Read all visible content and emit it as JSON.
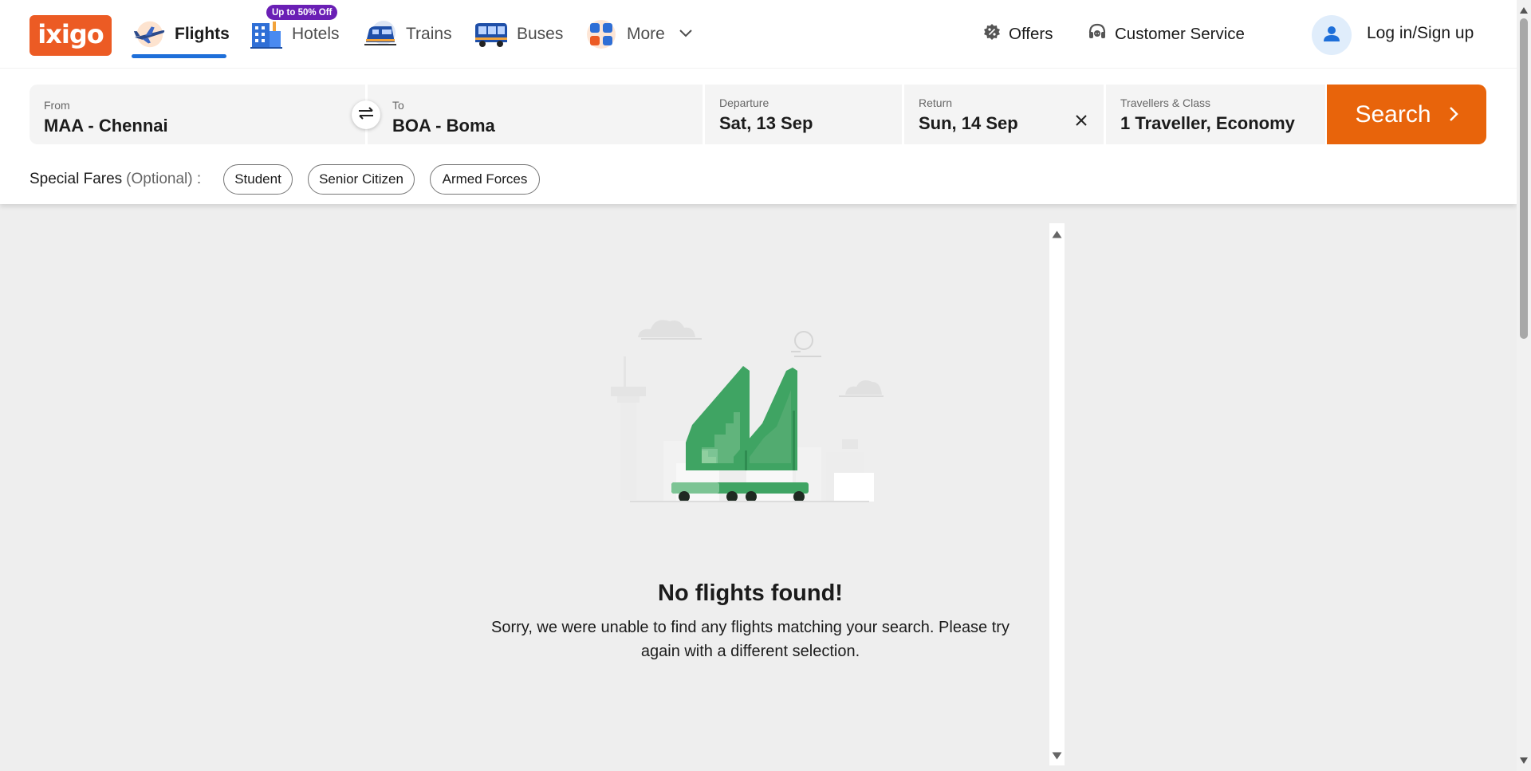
{
  "brand": {
    "logo_text": "ixigo"
  },
  "nav": {
    "items": [
      {
        "label": "Flights",
        "icon": "airplane-icon",
        "active": true
      },
      {
        "label": "Hotels",
        "icon": "hotel-building-icon",
        "badge": "Up to 50% Off"
      },
      {
        "label": "Trains",
        "icon": "train-icon"
      },
      {
        "label": "Buses",
        "icon": "bus-icon"
      },
      {
        "label": "More",
        "icon": "apps-grid-icon"
      }
    ]
  },
  "header_right": {
    "offers": "Offers",
    "customer_service": "Customer Service",
    "login": "Log in/Sign up"
  },
  "search": {
    "from": {
      "label": "From",
      "value": "MAA - Chennai"
    },
    "to": {
      "label": "To",
      "value": "BOA - Boma"
    },
    "departure": {
      "label": "Departure",
      "value": "Sat, 13 Sep"
    },
    "return": {
      "label": "Return",
      "value": "Sun, 14 Sep"
    },
    "travellers": {
      "label": "Travellers & Class",
      "value": "1 Traveller, Economy"
    },
    "button": "Search"
  },
  "special_fares": {
    "label": "Special Fares",
    "optional": "(Optional) :",
    "options": [
      "Student",
      "Senior Citizen",
      "Armed Forces"
    ]
  },
  "empty_state": {
    "title": "No flights found!",
    "message": "Sorry, we were unable to find any flights matching your search. Please try again with a different selection."
  },
  "colors": {
    "brand_orange": "#ec5b24",
    "search_button": "#e8640b",
    "active_underline": "#1e6fd9",
    "badge_purple": "#6a1fb5",
    "illustration_green": "#3fa463"
  }
}
